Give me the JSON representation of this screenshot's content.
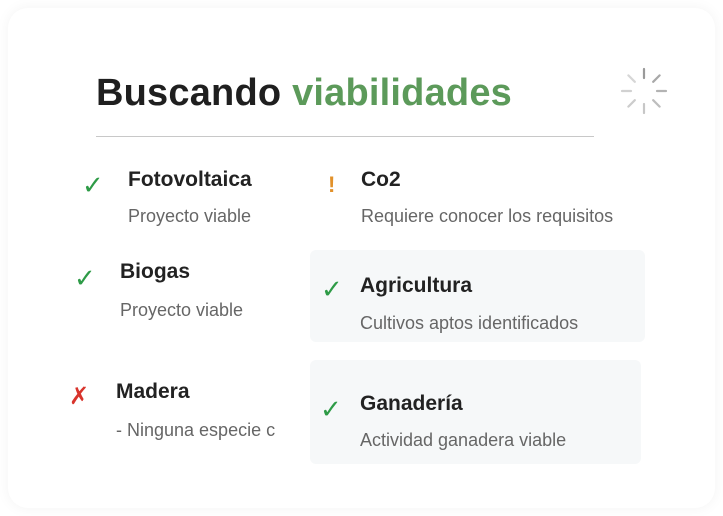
{
  "header": {
    "title_prefix": "Buscando",
    "title_accent": "viabilidades",
    "spinner_icon": "loading-spinner-icon"
  },
  "colors": {
    "accent": "#5c9a5a",
    "ok": "#2e9b47",
    "warning": "#e2912a",
    "error": "#d8342c"
  },
  "results": [
    {
      "id": "fotovoltaica",
      "status": "ok",
      "icon": "check-icon",
      "glyph": "✓",
      "title": "Fotovoltaica",
      "description": "Proyecto viable"
    },
    {
      "id": "co2",
      "status": "warning",
      "icon": "exclamation-icon",
      "glyph": "!",
      "title": "Co2",
      "description": "Requiere conocer los requisitos"
    },
    {
      "id": "biogas",
      "status": "ok",
      "icon": "check-icon",
      "glyph": "✓",
      "title": "Biogas",
      "description": "Proyecto viable"
    },
    {
      "id": "agricultura",
      "status": "ok",
      "icon": "check-icon",
      "glyph": "✓",
      "title": "Agricultura",
      "description": "Cultivos aptos identificados"
    },
    {
      "id": "madera",
      "status": "error",
      "icon": "cross-icon",
      "glyph": "✗",
      "title": "Madera",
      "description": "- Ninguna especie c"
    },
    {
      "id": "ganaderia",
      "status": "ok",
      "icon": "check-icon",
      "glyph": "✓",
      "title": "Ganadería",
      "description": "Actividad ganadera viable"
    }
  ]
}
